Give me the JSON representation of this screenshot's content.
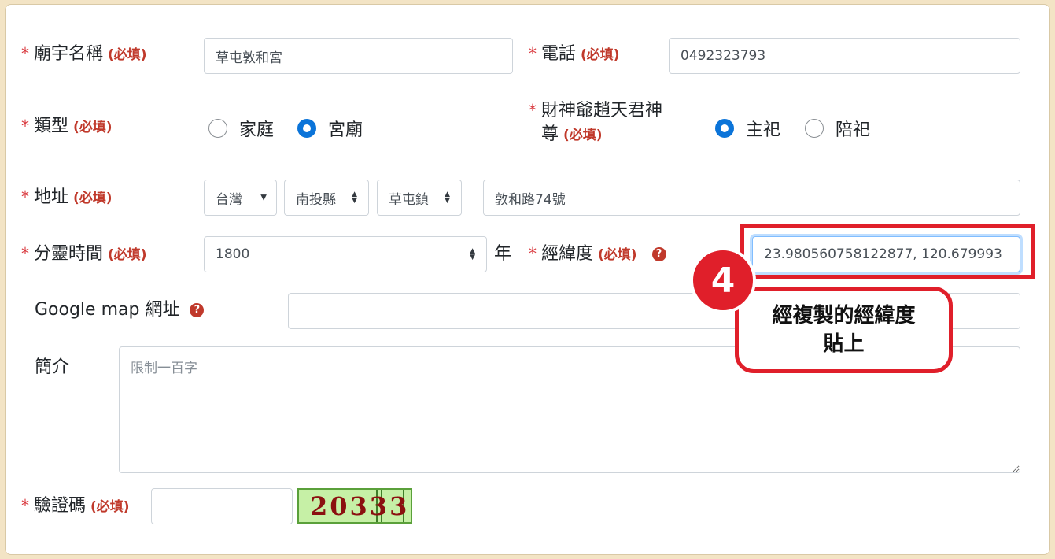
{
  "required_tag": "(必填)",
  "required_star": "*",
  "form": {
    "temple_name": {
      "label": "廟宇名稱",
      "value": "草屯敦和宮"
    },
    "phone": {
      "label": "電話",
      "value": "0492323793"
    },
    "type": {
      "label": "類型",
      "options": [
        "家庭",
        "宮廟"
      ],
      "selected": "宮廟"
    },
    "deity": {
      "label_line1": "財神爺趙天君神",
      "label_line2": "尊",
      "options": [
        "主祀",
        "陪祀"
      ],
      "selected": "主祀"
    },
    "address": {
      "label": "地址",
      "country": "台灣",
      "county": "南投縣",
      "town": "草屯鎮",
      "street": "敦和路74號"
    },
    "split_time": {
      "label": "分靈時間",
      "value": "1800",
      "suffix": "年"
    },
    "latlng": {
      "label": "經緯度",
      "value": "23.980560758122877, 120.679993",
      "help": "?"
    },
    "google_map": {
      "label": "Google map 網址",
      "value": "",
      "help": "?"
    },
    "intro": {
      "label": "簡介",
      "placeholder": "限制一百字"
    },
    "captcha": {
      "label": "驗證碼",
      "value": "",
      "image_text": "20333"
    }
  },
  "annotation": {
    "step": "4",
    "text_line1": "經複製的經緯度",
    "text_line2": "貼上",
    "color": "#e01f2a"
  },
  "colors": {
    "accent": "#0b74d9",
    "required": "#c0392b",
    "background": "#f3e4c5"
  }
}
